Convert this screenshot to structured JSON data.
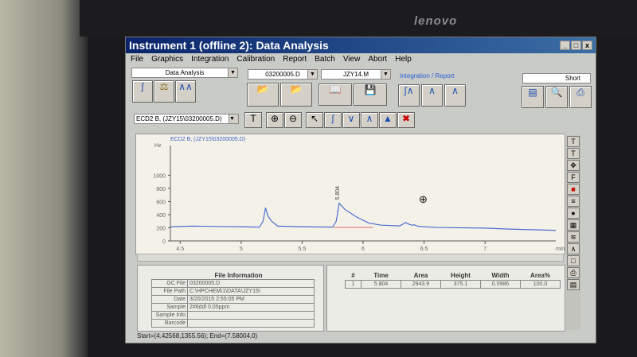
{
  "monitor": {
    "brand": "lenovo"
  },
  "window": {
    "title": "Instrument 1 (offline 2): Data Analysis",
    "controls": [
      "_",
      "□",
      "x"
    ]
  },
  "menu": [
    "File",
    "Graphics",
    "Integration",
    "Calibration",
    "Report",
    "Batch",
    "View",
    "Abort",
    "Help"
  ],
  "toolbar": {
    "view_select": "Data Analysis",
    "datafile_select": "03200005.D",
    "method_select": "JZY14.M",
    "integration_label": "Integration / Report",
    "report_style": "Short",
    "signal_select": "ECD2 B, (JZY15\\03200005.D)"
  },
  "chart_data": {
    "type": "line",
    "title": "ECD2 B, (JZY15\\03200005.D)",
    "ylabel": "Hz",
    "xlabel": "min",
    "xlim": [
      4.42,
      7.58
    ],
    "ylim": [
      0,
      1355
    ],
    "xticks": [
      4.5,
      5,
      5.5,
      6,
      6.5,
      7
    ],
    "yticks": [
      0,
      200,
      400,
      600,
      800,
      1000
    ],
    "peak_label": "5.804",
    "series": [
      {
        "name": "ECD2 B",
        "x": [
          4.42,
          4.6,
          4.8,
          5.0,
          5.15,
          5.18,
          5.2,
          5.22,
          5.25,
          5.3,
          5.5,
          5.75,
          5.78,
          5.804,
          5.85,
          5.95,
          6.05,
          6.15,
          6.3,
          6.35,
          6.38,
          6.4,
          6.42,
          6.45,
          6.6,
          7.0,
          7.2,
          7.58
        ],
        "y": [
          215,
          225,
          220,
          215,
          210,
          300,
          505,
          380,
          300,
          225,
          215,
          210,
          300,
          575,
          480,
          360,
          270,
          240,
          228,
          280,
          250,
          240,
          245,
          222,
          205,
          195,
          180,
          160
        ]
      }
    ],
    "baseline": {
      "x": [
        5.76,
        6.08
      ],
      "y": [
        205,
        205
      ]
    }
  },
  "file_info": {
    "title": "File Information",
    "rows": [
      [
        "GC File",
        "03200005.D"
      ],
      [
        "File Path",
        "C:\\HPCHEM\\1\\DATA\\JZY15\\"
      ],
      [
        "Date",
        "3/20/2015 2:55:05 PM"
      ],
      [
        "Sample",
        "2#6ddl 0.05ppm"
      ],
      [
        "Sample Info",
        ""
      ],
      [
        "Barcode",
        ""
      ]
    ]
  },
  "peaks": {
    "headers": [
      "#",
      "Time",
      "Area",
      "Height",
      "Width",
      "Area%"
    ],
    "rows": [
      [
        "1",
        "5.804",
        "2943.9",
        "375.1",
        "0.0986",
        "100.0"
      ]
    ]
  },
  "status": "Start=(4.42568,1355.56); End=(7.58004,0)"
}
